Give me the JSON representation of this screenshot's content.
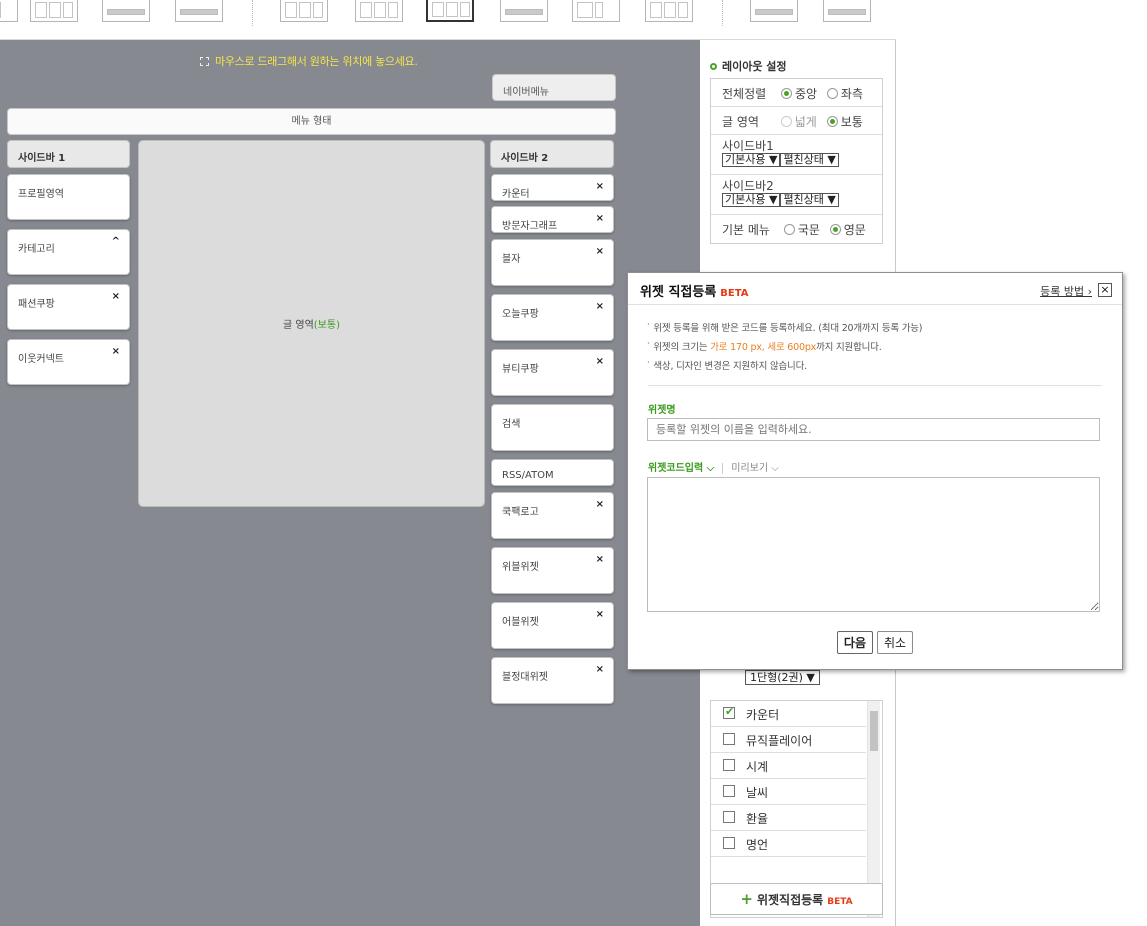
{
  "hint": "마우스로 드래그해서 원하는 위치에 놓으세요.",
  "layout": {
    "navermenu": "네이버메뉴",
    "menu_style": "메뉴 형태",
    "sidebar1_title": "사이드바 1",
    "sidebar2_title": "사이드바 2",
    "content_label": "글 영역",
    "content_mode": "(보통)",
    "sidebar1": [
      {
        "label": "프로필영역",
        "icon": ""
      },
      {
        "label": "카테고리",
        "icon": "^"
      },
      {
        "label": "패션쿠팡",
        "icon": "×"
      },
      {
        "label": "이웃커넥트",
        "icon": "×"
      }
    ],
    "sidebar2": [
      {
        "label": "카운터",
        "icon": "×"
      },
      {
        "label": "방문자그래프",
        "icon": "×"
      },
      {
        "label": "블자",
        "icon": "×"
      },
      {
        "label": "오늘쿠팡",
        "icon": "×"
      },
      {
        "label": "뷰티쿠팡",
        "icon": "×"
      },
      {
        "label": "검색",
        "icon": ""
      },
      {
        "label": "RSS/ATOM",
        "icon": ""
      },
      {
        "label": "쿡팩로고",
        "icon": "×"
      },
      {
        "label": "위블위젯",
        "icon": "×"
      },
      {
        "label": "어블위젯",
        "icon": "×"
      },
      {
        "label": "블정대위젯",
        "icon": "×"
      }
    ]
  },
  "settings": {
    "title": "레이아웃 설정",
    "align_label": "전체정렬",
    "align_center": "중앙",
    "align_left": "좌측",
    "area_label": "글 영역",
    "area_wide": "넓게",
    "area_normal": "보통",
    "sidebar1_label": "사이드바1",
    "sidebar2_label": "사이드바2",
    "sidebar_use": "기본사용 ▼",
    "sidebar_state": "펼친상태 ▼",
    "menu_label": "기본 메뉴",
    "menu_ko": "국문",
    "menu_en": "영문"
  },
  "widget_list": {
    "dropdown": "1단형(2권) ▼",
    "items": [
      {
        "label": "카운터",
        "checked": true
      },
      {
        "label": "뮤직플레이어",
        "checked": false
      },
      {
        "label": "시계",
        "checked": false
      },
      {
        "label": "날씨",
        "checked": false
      },
      {
        "label": "환율",
        "checked": false
      },
      {
        "label": "명언",
        "checked": false
      }
    ]
  },
  "register_button": {
    "label": "위젯직접등록",
    "badge": "BETA",
    "icon": "+"
  },
  "modal": {
    "title": "위젯 직접등록",
    "badge": "BETA",
    "how_link": "등록 방법 ›",
    "close": "×",
    "note1": "위젯 등록을 위해 받은 코드를 등록하세요. (최대 20개까지 등록 가능)",
    "note2_pre": "위젯의 크기는 ",
    "note2_hl": "가로 170 px, 세로 600px",
    "note2_post": "까지 지원합니다.",
    "note3": "색상, 디자인 변경은 지원하지 않습니다.",
    "name_label": "위젯명",
    "name_placeholder": "등록할 위젯의 이름을 입력하세요.",
    "code_tab": "위젯코드입력 ⌵",
    "preview_tab": "미리보기 ⌵",
    "next": "다음",
    "cancel": "취소"
  }
}
